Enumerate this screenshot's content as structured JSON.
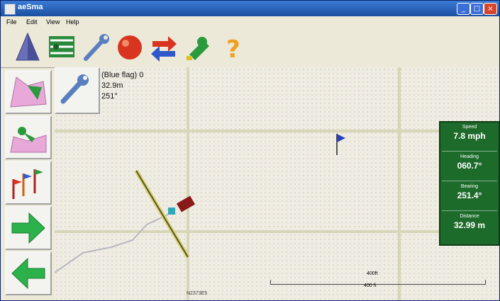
{
  "window": {
    "title": "aeSma"
  },
  "menu": {
    "items": [
      "File",
      "Edit",
      "View",
      "Help"
    ]
  },
  "toolbar": {
    "buttons": [
      {
        "icon": "pyramid-icon"
      },
      {
        "icon": "swath-lines-icon"
      },
      {
        "icon": "wrench-icon"
      },
      {
        "icon": "red-ball-icon"
      },
      {
        "icon": "swap-arrows-icon"
      },
      {
        "icon": "tractor-pin-icon"
      },
      {
        "icon": "help-icon"
      }
    ]
  },
  "sidebar": {
    "buttons": [
      {
        "icon": "field-map-icon"
      },
      {
        "icon": "field-boundary-icon"
      },
      {
        "icon": "flags-icon"
      },
      {
        "icon": "arrow-right-icon"
      },
      {
        "icon": "arrow-left-icon"
      }
    ]
  },
  "target_info": {
    "name": "(Blue flag) 0",
    "distance": "32.9m",
    "bearing": "251°"
  },
  "stats": {
    "speed": {
      "label": "Speed",
      "value": "7.8 mph"
    },
    "heading": {
      "label": "Heading",
      "value": "060.7°"
    },
    "bearing": {
      "label": "Bearing",
      "value": "251.4°"
    },
    "distance": {
      "label": "Distance",
      "value": "32.99 m"
    }
  },
  "scale": {
    "top_label": "400ft",
    "bottom_label": "400 ft"
  },
  "status": {
    "coordinate": "N2373E5"
  },
  "colors": {
    "panel_green": "#1d6b2a",
    "arrow_green": "#2bb24a",
    "flag_blue": "#2840b8"
  }
}
